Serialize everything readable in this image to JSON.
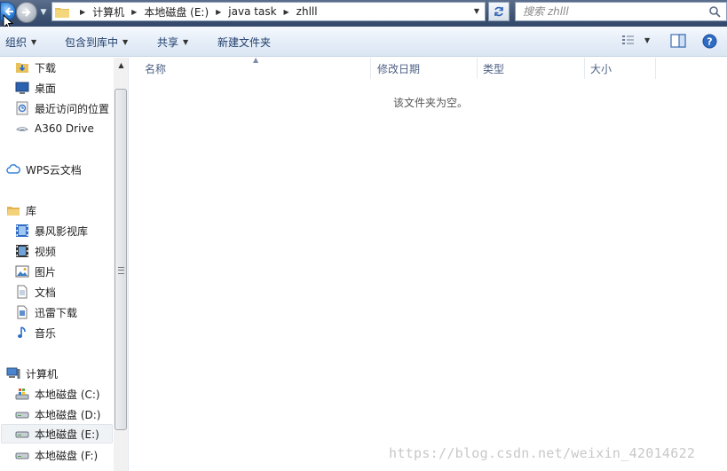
{
  "address": {
    "crumbs": [
      "计算机",
      "本地磁盘 (E:)",
      "java task",
      "zhlll"
    ]
  },
  "search": {
    "placeholder": "搜索 zhlll"
  },
  "toolbar": {
    "organize": "组织",
    "include_in_library": "包含到库中",
    "share": "共享",
    "new_folder": "新建文件夹"
  },
  "sidebar": {
    "items": [
      {
        "label": "下载",
        "icon": "download-folder-icon"
      },
      {
        "label": "桌面",
        "icon": "desktop-icon"
      },
      {
        "label": "最近访问的位置",
        "icon": "recent-places-icon"
      },
      {
        "label": "A360 Drive",
        "icon": "a360-drive-icon"
      },
      {
        "label": "WPS云文档",
        "icon": "cloud-icon"
      },
      {
        "label": "库",
        "icon": "library-icon"
      },
      {
        "label": "暴风影视库",
        "icon": "video-library-icon"
      },
      {
        "label": "视频",
        "icon": "video-icon"
      },
      {
        "label": "图片",
        "icon": "pictures-icon"
      },
      {
        "label": "文档",
        "icon": "documents-icon"
      },
      {
        "label": "迅雷下载",
        "icon": "thunder-download-icon"
      },
      {
        "label": "音乐",
        "icon": "music-icon"
      },
      {
        "label": "计算机",
        "icon": "computer-icon"
      },
      {
        "label": "本地磁盘 (C:)",
        "icon": "windows-drive-icon"
      },
      {
        "label": "本地磁盘 (D:)",
        "icon": "drive-icon"
      },
      {
        "label": "本地磁盘 (E:)",
        "icon": "drive-icon",
        "selected": true
      },
      {
        "label": "本地磁盘 (F:)",
        "icon": "drive-icon"
      }
    ]
  },
  "columns": [
    "名称",
    "修改日期",
    "类型",
    "大小"
  ],
  "empty_message": "该文件夹为空。",
  "watermark": "https://blog.csdn.net/weixin_42014622",
  "colors": {
    "toolbar_text": "#1e3d6b",
    "header_text": "#4d6185",
    "title_bar": "#3f5373"
  }
}
